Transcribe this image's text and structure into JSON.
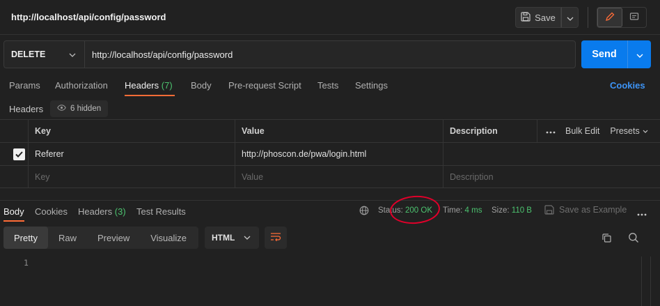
{
  "header": {
    "title": "http://localhost/api/config/password",
    "save_label": "Save"
  },
  "request": {
    "method": "DELETE",
    "url": "http://localhost/api/config/password",
    "send_label": "Send"
  },
  "request_tabs": {
    "params": "Params",
    "authorization": "Authorization",
    "headers": "Headers",
    "headers_count": "(7)",
    "body": "Body",
    "prerequest": "Pre-request Script",
    "tests": "Tests",
    "settings": "Settings",
    "cookies": "Cookies"
  },
  "headers_section": {
    "label": "Headers",
    "hidden": "6 hidden"
  },
  "table": {
    "col_key": "Key",
    "col_value": "Value",
    "col_description": "Description",
    "bulk_edit": "Bulk Edit",
    "presets": "Presets",
    "rows": [
      {
        "key": "Referer",
        "value": "http://phoscon.de/pwa/login.html",
        "description": "",
        "checked": true
      }
    ],
    "placeholder_key": "Key",
    "placeholder_value": "Value",
    "placeholder_description": "Description"
  },
  "response_tabs": {
    "body": "Body",
    "cookies": "Cookies",
    "headers": "Headers",
    "headers_count": "(3)",
    "test_results": "Test Results"
  },
  "response_meta": {
    "status_label": "Status:",
    "status_value": "200 OK",
    "time_label": "Time:",
    "time_value": "4 ms",
    "size_label": "Size:",
    "size_value": "110 B",
    "save_example": "Save as Example"
  },
  "response_view": {
    "pretty": "Pretty",
    "raw": "Raw",
    "preview": "Preview",
    "visualize": "Visualize",
    "format": "HTML",
    "line_number": "1"
  },
  "colors": {
    "accent_orange": "#ff6c37",
    "send_blue": "#097bed",
    "status_green": "#4cc26f",
    "annotation_red": "#e0002a"
  }
}
